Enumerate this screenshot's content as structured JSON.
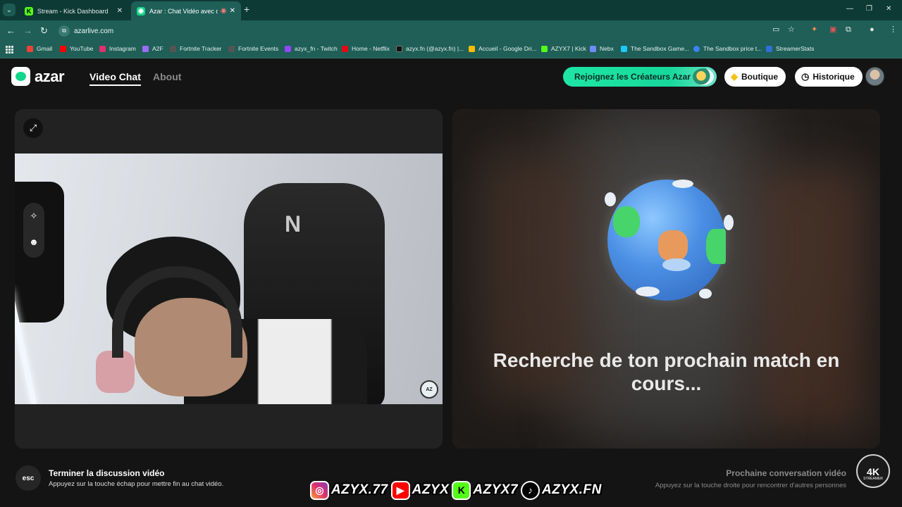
{
  "browser": {
    "tabs": [
      {
        "title": "Stream - Kick Dashboard",
        "favicon": "kick-icon",
        "active": false
      },
      {
        "title": "Azar : Chat Vidéo avec de n",
        "favicon": "azar-icon",
        "active": true
      }
    ],
    "address": "azarlive.com",
    "bookmarks": [
      {
        "label": "Gmail",
        "color": "#ea4335"
      },
      {
        "label": "YouTube",
        "color": "#ff0000"
      },
      {
        "label": "Instagram",
        "color": "#e1306c"
      },
      {
        "label": "A2F",
        "color": "#9b6bff"
      },
      {
        "label": "Fortnite Tracker",
        "color": "#333333"
      },
      {
        "label": "Fortnite Events",
        "color": "#333333"
      },
      {
        "label": "azyx_fn - Twitch",
        "color": "#9146ff"
      },
      {
        "label": "Home - Netflix",
        "color": "#e50914"
      },
      {
        "label": "azyx.fn (@azyx.fn) |...",
        "color": "#111111"
      },
      {
        "label": "Accueil - Google Dri...",
        "color": "#fbbc04"
      },
      {
        "label": "AZYX7 | Kick",
        "color": "#53fc18"
      },
      {
        "label": "Nebx",
        "color": "#6e8cff"
      },
      {
        "label": "The Sandbox Game...",
        "color": "#1ec8ff"
      },
      {
        "label": "The Sandbox price t...",
        "color": "#3b82f6"
      },
      {
        "label": "StreamerStats",
        "color": "#2f6fd6"
      }
    ]
  },
  "header": {
    "logo_text": "azar",
    "nav": [
      {
        "label": "Video Chat",
        "active": true
      },
      {
        "label": "About",
        "active": false
      }
    ],
    "creators_button": "Rejoignez les Créateurs Azar",
    "shop_button": "Boutique",
    "history_button": "Historique"
  },
  "right_panel": {
    "status_line1": "Recherche de ton prochain match en",
    "status_line2": "cours..."
  },
  "footer": {
    "esc_key": "esc",
    "end_title": "Terminer la discussion vidéo",
    "end_subtitle": "Appuyez sur la touche échap pour mettre fin au chat vidéo.",
    "next_title": "Prochaine conversation vidéo",
    "next_subtitle": "Appuyez sur la touche droite pour rencontrer d'autres personnes"
  },
  "overlay": {
    "socials": [
      {
        "platform": "instagram-icon",
        "handle": "AZYX.77",
        "color": "#e1306c"
      },
      {
        "platform": "youtube-icon",
        "handle": "AZYX",
        "color": "#ff0000"
      },
      {
        "platform": "kick-icon",
        "handle": "AZYX7",
        "color": "#53fc18"
      },
      {
        "platform": "tiktok-icon",
        "handle": "AZYX.FN",
        "color": "#000000"
      }
    ],
    "badge_line1": "4K",
    "badge_line2": "STREAMER"
  }
}
